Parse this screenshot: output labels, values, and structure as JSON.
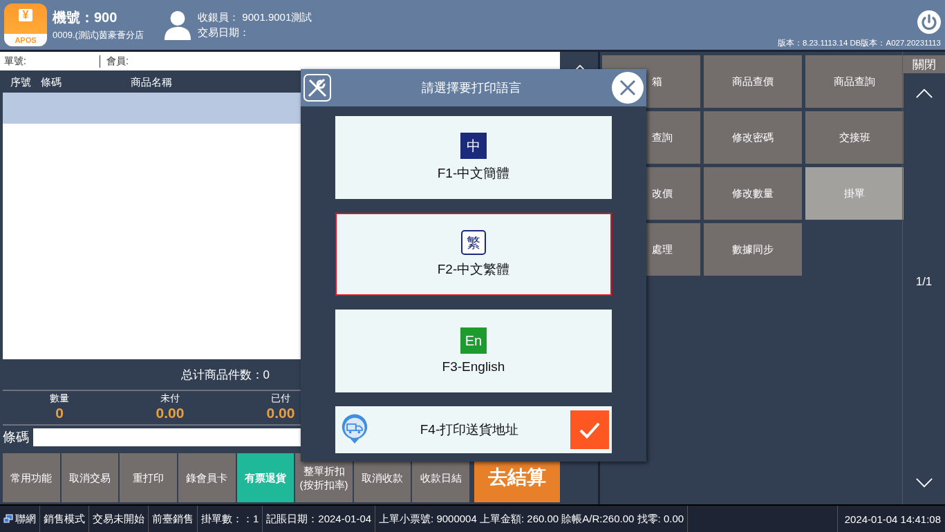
{
  "header": {
    "logo_symbol": "¥",
    "logo_text": "APOS",
    "terminal": "機號：900",
    "store": "0009.(測試)茵豪薈分店",
    "cashier": "收銀員：  9001.9001測試",
    "trade_date": "交易日期：",
    "version": "版本：8.23.1113.14 DB版本：A027.20231113"
  },
  "order_bar": {
    "order_no": "單號:",
    "member": "會員:"
  },
  "table": {
    "columns": [
      "序號",
      "條碼",
      "商品名稱"
    ]
  },
  "total_count": "总计商品件数：0",
  "summary": [
    {
      "label": "數量",
      "value": "0"
    },
    {
      "label": "未付",
      "value": "0.00"
    },
    {
      "label": "已付",
      "value": "0.00"
    }
  ],
  "barcode": {
    "label": "條碼"
  },
  "actions": [
    {
      "label": "常用功能",
      "kind": "normal"
    },
    {
      "label": "取消交易",
      "kind": "normal"
    },
    {
      "label": "重打印",
      "kind": "normal"
    },
    {
      "label": "錄會員卡",
      "kind": "normal"
    },
    {
      "label": "有票退貨",
      "kind": "active"
    },
    {
      "label": "整單折扣(按折扣率)",
      "kind": "normal"
    },
    {
      "label": "取消收款",
      "kind": "normal"
    },
    {
      "label": "收款日結",
      "kind": "normal"
    },
    {
      "label": "去結算",
      "kind": "checkout"
    }
  ],
  "functions": [
    {
      "label": "箱",
      "highlighted": false
    },
    {
      "label": "商品查價",
      "highlighted": false
    },
    {
      "label": "商品查詢",
      "highlighted": false
    },
    {
      "label": "查詢",
      "highlighted": false
    },
    {
      "label": "修改密碼",
      "highlighted": false
    },
    {
      "label": "交接班",
      "highlighted": false
    },
    {
      "label": "改價",
      "highlighted": false
    },
    {
      "label": "修改數量",
      "highlighted": false
    },
    {
      "label": "掛單",
      "highlighted": true
    },
    {
      "label": "處理",
      "highlighted": false
    },
    {
      "label": "數據同步",
      "highlighted": false
    }
  ],
  "side": {
    "close": "關閉",
    "page": "1/1"
  },
  "dialog": {
    "title": "請選擇要打印語言",
    "options": [
      {
        "badge": "中",
        "kind": "filled",
        "color": "#1b2a7a",
        "label": "F1-中文簡體",
        "selected": false
      },
      {
        "badge": "繁",
        "kind": "outlined",
        "color": "#1b2a7a",
        "label": "F2-中文繁體",
        "selected": true
      },
      {
        "badge": "En",
        "kind": "filled",
        "color": "#1e9b2e",
        "label": "F3-English",
        "selected": false
      }
    ],
    "address": {
      "label": "F4-打印送貨地址",
      "checked": true
    }
  },
  "status_bar": {
    "network": "聯網",
    "items": [
      "銷售模式",
      "交易未開始",
      "前臺銷售",
      "掛單數：：1",
      "記賬日期：2024-01-04",
      "上單小票號: 9000004 上單金額: 260.00  賒帳A/R:260.00 找零: 0.00"
    ],
    "clock": "2024-01-04 14:41:08"
  }
}
